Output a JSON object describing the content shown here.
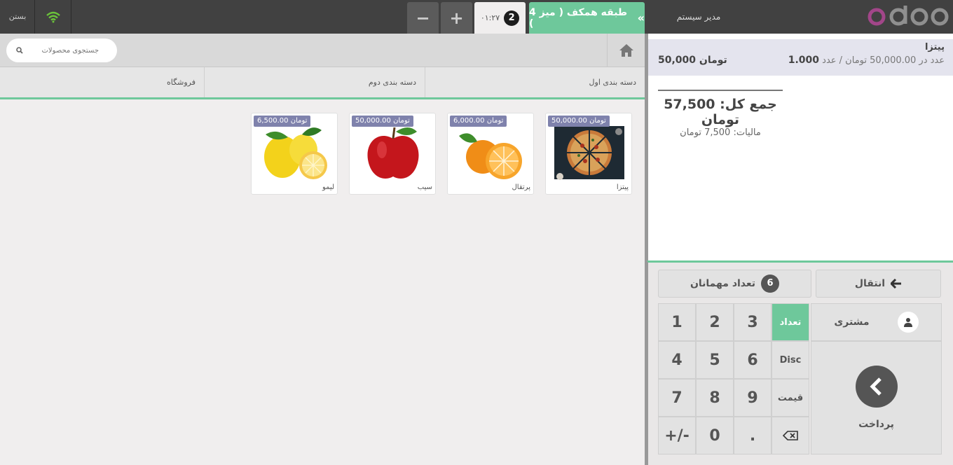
{
  "topbar": {
    "user": "مدیر سیستم",
    "active_order": "طبقه همکف ( میز 4 )",
    "order_badge": "2",
    "order_time": "۰۱:۲۷",
    "add_label": "+",
    "remove_label": "−",
    "close_label": "بستن"
  },
  "order": {
    "line": {
      "name": "پیتزا",
      "qty": "1.000",
      "qty_detail": "عدد در 50,000.00 تومان / عدد",
      "price": "50,000 تومان"
    },
    "total": "جمع کل: 57,500 تومان",
    "tax": "مالیات: 7,500 تومان"
  },
  "controls": {
    "transfer": "انتقال",
    "guests_count": "6",
    "guests": "تعداد مهمانان"
  },
  "numpad": {
    "keys": [
      "1",
      "2",
      "3",
      "4",
      "5",
      "6",
      "7",
      "8",
      "9",
      "+/-",
      "0",
      "."
    ],
    "qty": "تعداد",
    "disc": "Disc",
    "price": "قیمت"
  },
  "actionpad": {
    "customer": "مشتری",
    "payment": "پرداخت"
  },
  "search": {
    "placeholder": "جستجوی محصولات"
  },
  "categories": [
    "دسته بندی اول",
    "دسته بندی دوم",
    "فروشگاه"
  ],
  "products": [
    {
      "name": "پیتزا",
      "price": "50,000.00 تومان"
    },
    {
      "name": "پرتقال",
      "price": "6,000.00 تومان"
    },
    {
      "name": "سیب",
      "price": "50,000.00 تومان"
    },
    {
      "name": "لیمو",
      "price": "6,500.00 تومان"
    }
  ],
  "colors": {
    "accent": "#6ec89b",
    "topbar": "#414141",
    "price_tag": "#7f82ac"
  }
}
